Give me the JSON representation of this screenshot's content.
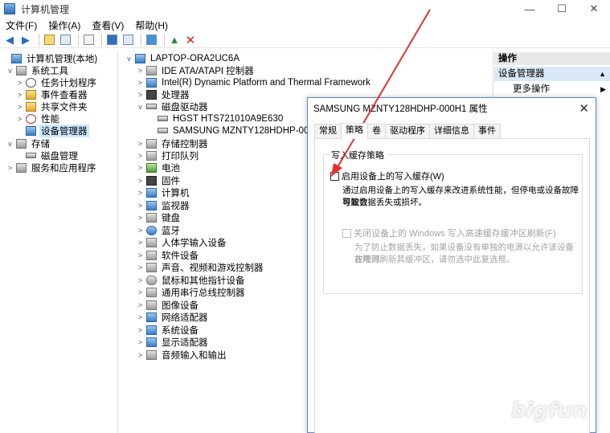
{
  "window": {
    "title": "计算机管理",
    "controls": [
      "—",
      "☐",
      "✕"
    ]
  },
  "menu": [
    "文件(F)",
    "操作(A)",
    "查看(V)",
    "帮助(H)"
  ],
  "left_tree": [
    {
      "label": "计算机管理(本地)",
      "level": 0,
      "expander": ""
    },
    {
      "label": "系统工具",
      "level": 1,
      "expander": "v"
    },
    {
      "label": "任务计划程序",
      "level": 2,
      "expander": ">"
    },
    {
      "label": "事件查看器",
      "level": 2,
      "expander": ">"
    },
    {
      "label": "共享文件夹",
      "level": 2,
      "expander": ">"
    },
    {
      "label": "性能",
      "level": 2,
      "expander": ">"
    },
    {
      "label": "设备管理器",
      "level": 2,
      "expander": ""
    },
    {
      "label": "存储",
      "level": 1,
      "expander": "v"
    },
    {
      "label": "磁盘管理",
      "level": 2,
      "expander": ""
    },
    {
      "label": "服务和应用程序",
      "level": 1,
      "expander": ">"
    }
  ],
  "device_tree": [
    {
      "label": "LAPTOP-ORA2UC6A",
      "level": 0,
      "expander": "v"
    },
    {
      "label": "IDE ATA/ATAPI 控制器",
      "level": 1,
      "expander": ">"
    },
    {
      "label": "Intel(R) Dynamic Platform and Thermal Framework",
      "level": 1,
      "expander": ">"
    },
    {
      "label": "处理器",
      "level": 1,
      "expander": ">"
    },
    {
      "label": "磁盘驱动器",
      "level": 1,
      "expander": "v"
    },
    {
      "label": "HGST HTS721010A9E630",
      "level": 2,
      "expander": ""
    },
    {
      "label": "SAMSUNG MZNTY128HDHP-000H1",
      "level": 2,
      "expander": ""
    },
    {
      "label": "存储控制器",
      "level": 1,
      "expander": ">"
    },
    {
      "label": "打印队列",
      "level": 1,
      "expander": ">"
    },
    {
      "label": "电池",
      "level": 1,
      "expander": ">"
    },
    {
      "label": "固件",
      "level": 1,
      "expander": ">"
    },
    {
      "label": "计算机",
      "level": 1,
      "expander": ">"
    },
    {
      "label": "监视器",
      "level": 1,
      "expander": ">"
    },
    {
      "label": "键盘",
      "level": 1,
      "expander": ">"
    },
    {
      "label": "蓝牙",
      "level": 1,
      "expander": ">"
    },
    {
      "label": "人体学输入设备",
      "level": 1,
      "expander": ">"
    },
    {
      "label": "软件设备",
      "level": 1,
      "expander": ">"
    },
    {
      "label": "声音、视频和游戏控制器",
      "level": 1,
      "expander": ">"
    },
    {
      "label": "鼠标和其他指针设备",
      "level": 1,
      "expander": ">"
    },
    {
      "label": "通用串行总线控制器",
      "level": 1,
      "expander": ">"
    },
    {
      "label": "图像设备",
      "level": 1,
      "expander": ">"
    },
    {
      "label": "网络适配器",
      "level": 1,
      "expander": ">"
    },
    {
      "label": "系统设备",
      "level": 1,
      "expander": ">"
    },
    {
      "label": "显示适配器",
      "level": 1,
      "expander": ">"
    },
    {
      "label": "音频输入和输出",
      "level": 1,
      "expander": ">"
    }
  ],
  "actions_pane": {
    "header": "操作",
    "section": "设备管理器",
    "more": "更多操作"
  },
  "dialog": {
    "title": "SAMSUNG MZNTY128HDHP-000H1 属性",
    "tabs": [
      "常规",
      "策略",
      "卷",
      "驱动程序",
      "详细信息",
      "事件"
    ],
    "active_tab": "策略",
    "group_title": "写入缓存策略",
    "enable_cache_label": "启用设备上的写入缓存(W)",
    "enable_cache_desc_1": "通过启用设备上的写入缓存来改进系统性能，但停电或设备故障可能会",
    "enable_cache_desc_2": "导致数据丢失或损坏。",
    "flush_label": "关闭设备上的 Windows 写入高速缓存缓冲区刷新(F)",
    "flush_desc_1": "为了防止数据丢失，如果设备没有单独的电源以允许该设备在电源",
    "flush_desc_2": "故障时刷新其缓冲区，请勿选中此复选框。"
  },
  "watermark": "bigfun"
}
